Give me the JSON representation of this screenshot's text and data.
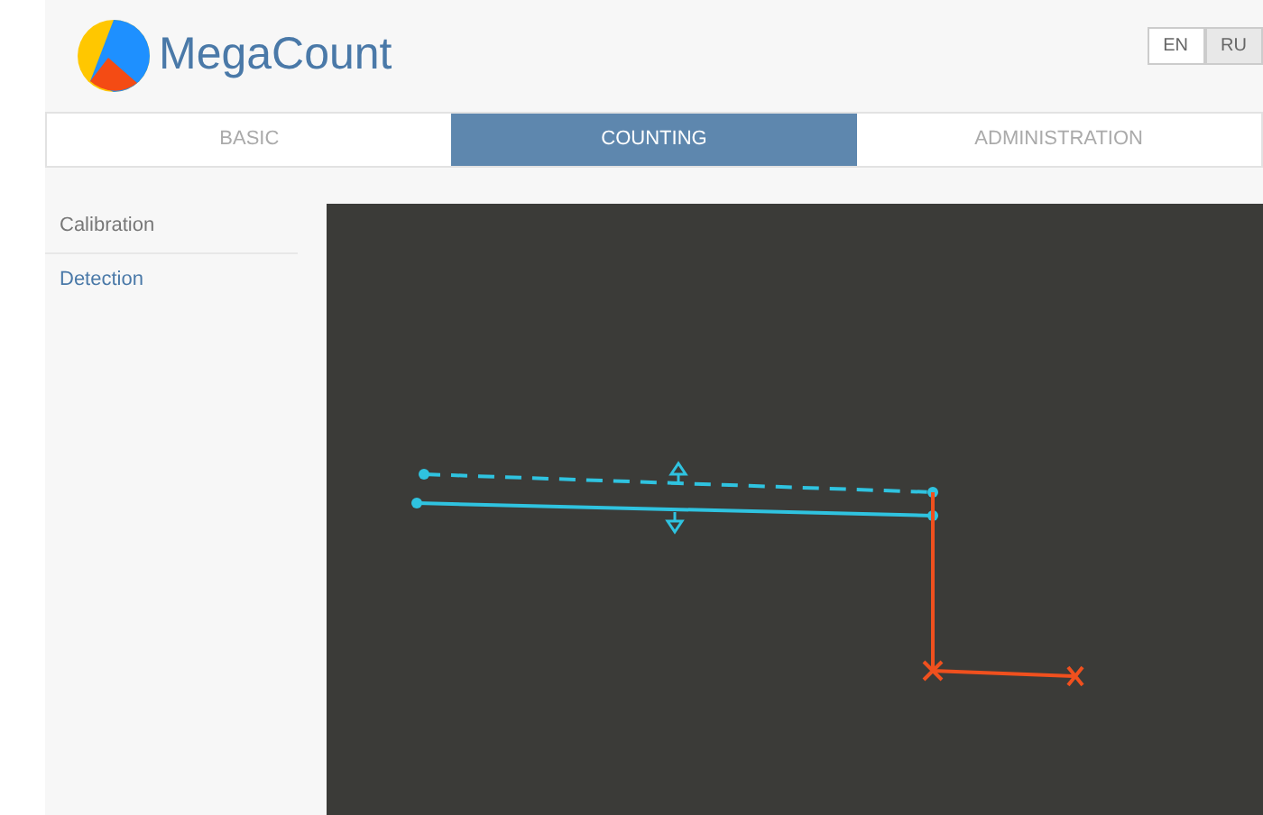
{
  "logo": {
    "text": "MegaCount"
  },
  "languages": [
    {
      "label": "EN",
      "selected": true
    },
    {
      "label": "RU",
      "selected": false
    }
  ],
  "tabs": [
    {
      "label": "BASIC",
      "selected": false
    },
    {
      "label": "COUNTING",
      "selected": true
    },
    {
      "label": "ADMINISTRATION",
      "selected": false
    }
  ],
  "sidebar": {
    "items": [
      {
        "label": "Calibration",
        "selected": false
      },
      {
        "label": "Detection",
        "selected": true
      }
    ]
  }
}
